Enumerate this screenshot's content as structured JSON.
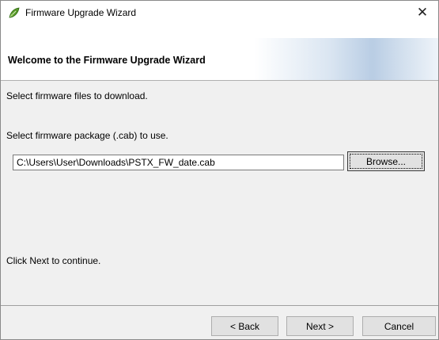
{
  "window": {
    "title": "Firmware Upgrade Wizard",
    "close_glyph": "✕",
    "icon": "wizard-leaf-icon",
    "accent_green": "#5a9a2c"
  },
  "header": {
    "title": "Welcome to the Firmware Upgrade Wizard"
  },
  "content": {
    "instructions": "Select firmware files to download.",
    "package_label": "Select firmware package (.cab) to use.",
    "package_path": "C:\\Users\\User\\Downloads\\PSTX_FW_date.cab",
    "browse_label": "Browse...",
    "continue_hint": "Click Next to continue."
  },
  "footer": {
    "back_label": "< Back",
    "next_label": "Next >",
    "cancel_label": "Cancel"
  }
}
